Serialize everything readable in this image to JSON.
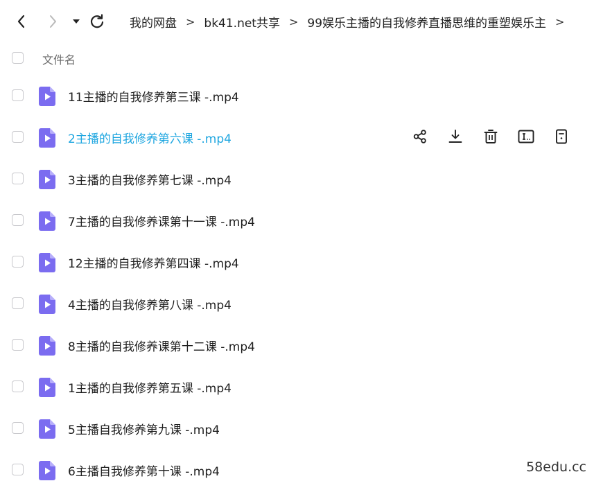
{
  "breadcrumb": [
    "我的网盘",
    "bk41.net共享",
    "99娱乐主播的自我修养直播思维的重塑娱乐主"
  ],
  "breadcrumb_separator": ">",
  "header": {
    "label": "文件名"
  },
  "files": [
    {
      "name": "11主播的自我修养第三课 -.mp4",
      "active": false
    },
    {
      "name": "2主播的自我修养第六课 -.mp4",
      "active": true
    },
    {
      "name": "3主播的自我修养第七课 -.mp4",
      "active": false
    },
    {
      "name": "7主播的自我修养课第十一课 -.mp4",
      "active": false
    },
    {
      "name": "12主播的自我修养第四课 -.mp4",
      "active": false
    },
    {
      "name": "4主播的自我修养第八课 -.mp4",
      "active": false
    },
    {
      "name": "8主播的自我修养课第十二课 -.mp4",
      "active": false
    },
    {
      "name": "1主播的自我修养第五课 -.mp4",
      "active": false
    },
    {
      "name": "5主播自我修养第九课 -.mp4",
      "active": false
    },
    {
      "name": "6主播自我修养第十课 -.mp4",
      "active": false
    }
  ],
  "row_actions": [
    "share-icon",
    "download-icon",
    "delete-icon",
    "rename-icon",
    "more-icon"
  ],
  "watermark": "58edu.cc",
  "colors": {
    "active_text": "#1ea6e0",
    "file_icon": "#7b6cf0",
    "file_icon_fold": "#b7aefb"
  }
}
